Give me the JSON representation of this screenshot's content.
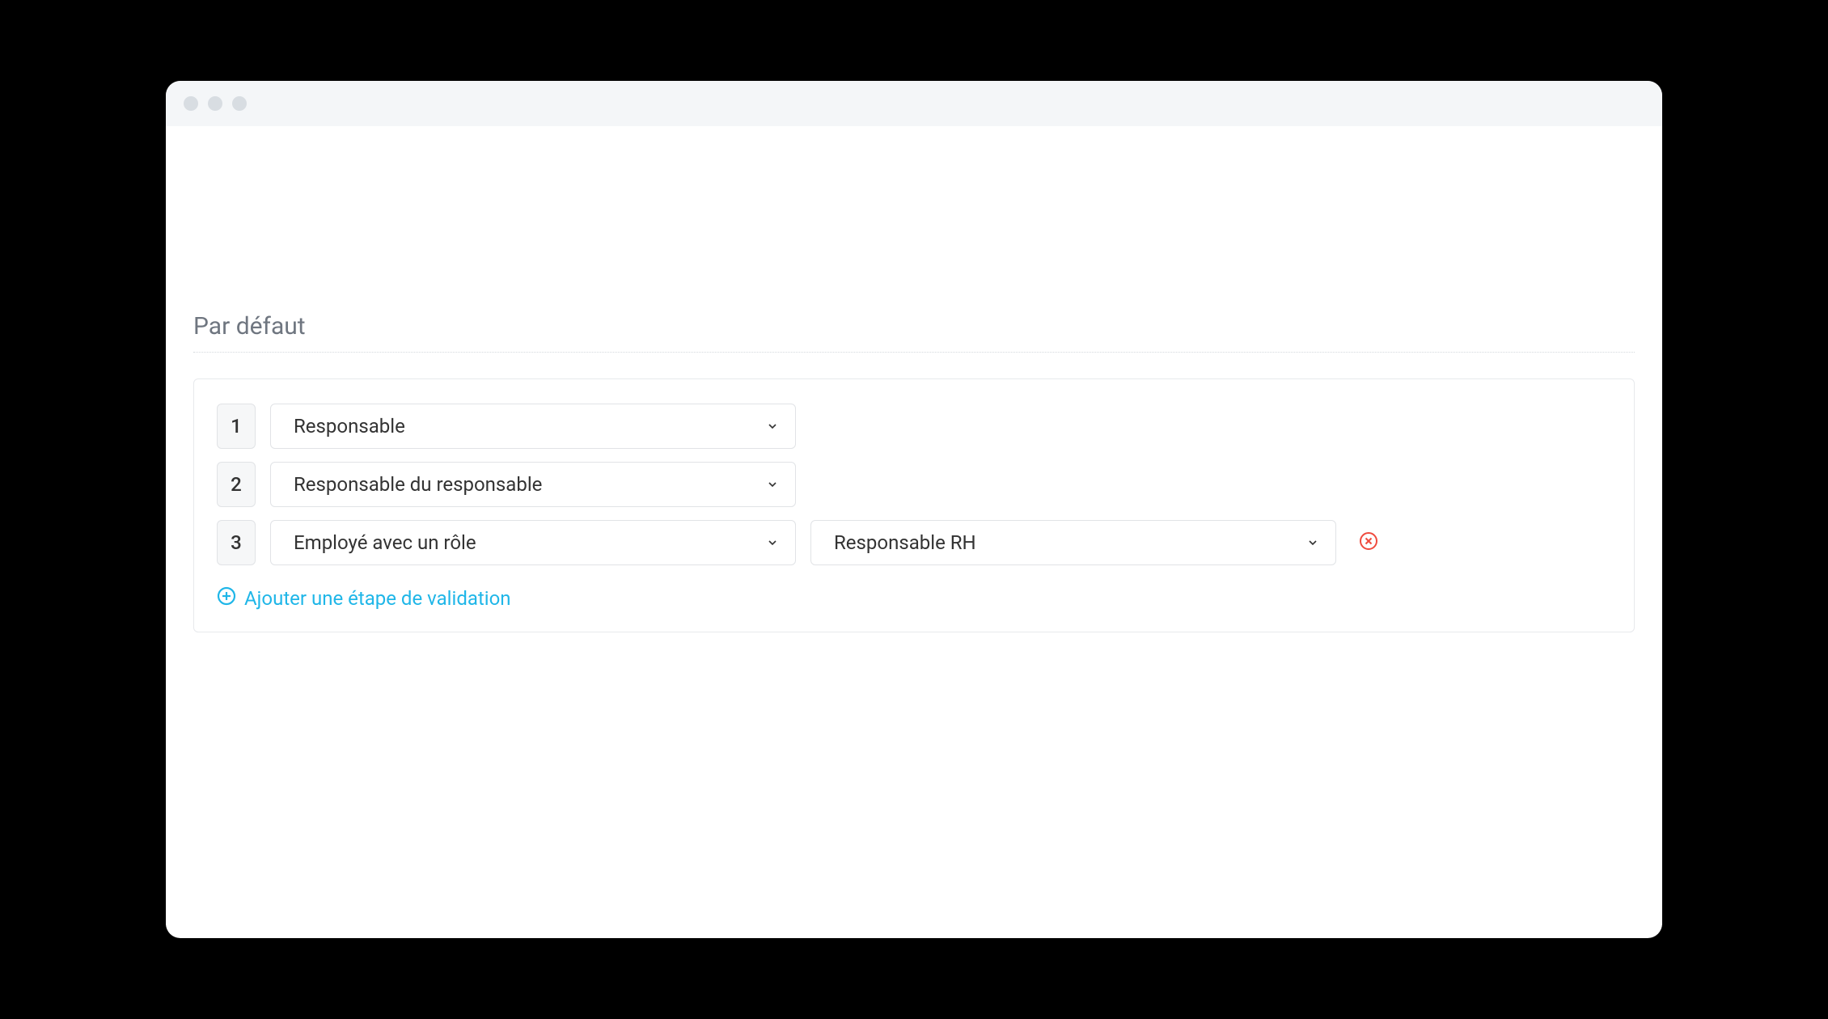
{
  "section": {
    "title": "Par défaut"
  },
  "steps": [
    {
      "num": "1",
      "approver": "Responsable",
      "role": null,
      "deletable": false
    },
    {
      "num": "2",
      "approver": "Responsable du responsable",
      "role": null,
      "deletable": false
    },
    {
      "num": "3",
      "approver": "Employé avec un rôle",
      "role": "Responsable RH",
      "deletable": true
    }
  ],
  "add_step_label": "Ajouter une étape de validation"
}
